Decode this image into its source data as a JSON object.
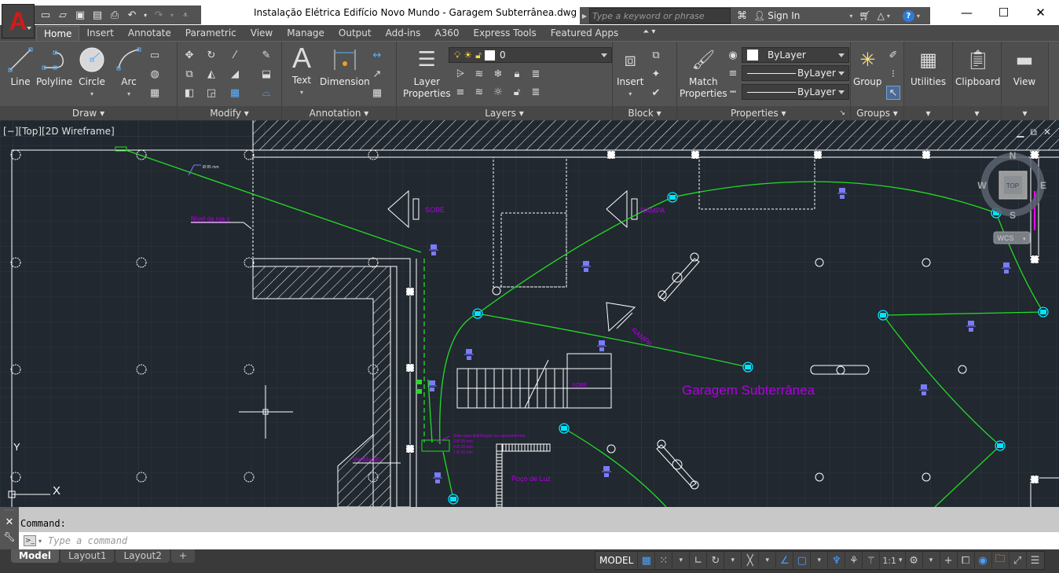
{
  "app": {
    "title": "Instalação Elétrica Edifício Novo Mundo - Garagem Subterrânea.dwg",
    "logo_letter": "A",
    "search_placeholder": "Type a keyword or phrase",
    "sign_in": "Sign In",
    "window_controls": [
      "minimize",
      "maximize",
      "close"
    ]
  },
  "quick_access": [
    "new-icon",
    "open-icon",
    "save-icon",
    "save-as-icon",
    "plot-icon",
    "undo-icon",
    "redo-icon",
    "customize-icon"
  ],
  "tabs": [
    {
      "label": "Home",
      "active": true
    },
    {
      "label": "Insert"
    },
    {
      "label": "Annotate"
    },
    {
      "label": "Parametric"
    },
    {
      "label": "View"
    },
    {
      "label": "Manage"
    },
    {
      "label": "Output"
    },
    {
      "label": "Add-ins"
    },
    {
      "label": "A360"
    },
    {
      "label": "Express Tools"
    },
    {
      "label": "Featured Apps"
    }
  ],
  "ribbon": {
    "draw": {
      "title": "Draw",
      "line": "Line",
      "polyline": "Polyline",
      "circle": "Circle",
      "arc": "Arc"
    },
    "modify": {
      "title": "Modify"
    },
    "annotation": {
      "title": "Annotation",
      "text": "Text",
      "dimension": "Dimension"
    },
    "layers": {
      "title": "Layers",
      "layer_properties_1": "Layer",
      "layer_properties_2": "Properties",
      "current_layer": "0"
    },
    "block": {
      "title": "Block",
      "insert": "Insert"
    },
    "properties": {
      "title": "Properties",
      "match_1": "Match",
      "match_2": "Properties",
      "color": "ByLayer",
      "lineweight": "ByLayer",
      "linetype": "ByLayer"
    },
    "groups": {
      "title": "Groups",
      "group": "Group"
    },
    "utilities": "Utilities",
    "clipboard": "Clipboard",
    "view": "View"
  },
  "viewport": {
    "label": "[−][Top][2D Wireframe]",
    "view_cube": {
      "top": "TOP",
      "n": "N",
      "s": "S",
      "e": "E",
      "w": "W",
      "wcs": "WCS"
    },
    "ucs": {
      "x": "X",
      "y": "Y"
    },
    "drawing_texts": {
      "title": "Garagem Subterrânea",
      "sobe1": "SOBE",
      "rampa1": "RAMPA",
      "rampa2": "RAMPA",
      "sobe2": "SOBE",
      "nivel": "Nível da rua ±",
      "diam": "Ø 85 mm",
      "ventilacao": "Ventilação",
      "poco": "Poço de Luz",
      "note1": "Sobe para distribuição nos apartamentos:",
      "note2": "3 Ø 25 mm",
      "note3": "4 Ø 20 mm",
      "note4": "1 Ø 50 mm"
    }
  },
  "command": {
    "history": "Command:",
    "placeholder": "Type a command"
  },
  "layout_tabs": [
    {
      "label": "Model",
      "active": true
    },
    {
      "label": "Layout1"
    },
    {
      "label": "Layout2"
    },
    {
      "label": "+"
    }
  ],
  "status": {
    "model": "MODEL",
    "scale": "1:1"
  },
  "colors": {
    "background": "#212830",
    "conduit": "#22dd22",
    "fixture": "#00e5ff",
    "switch": "#7b7bff",
    "text_magenta": "#b000e0"
  }
}
